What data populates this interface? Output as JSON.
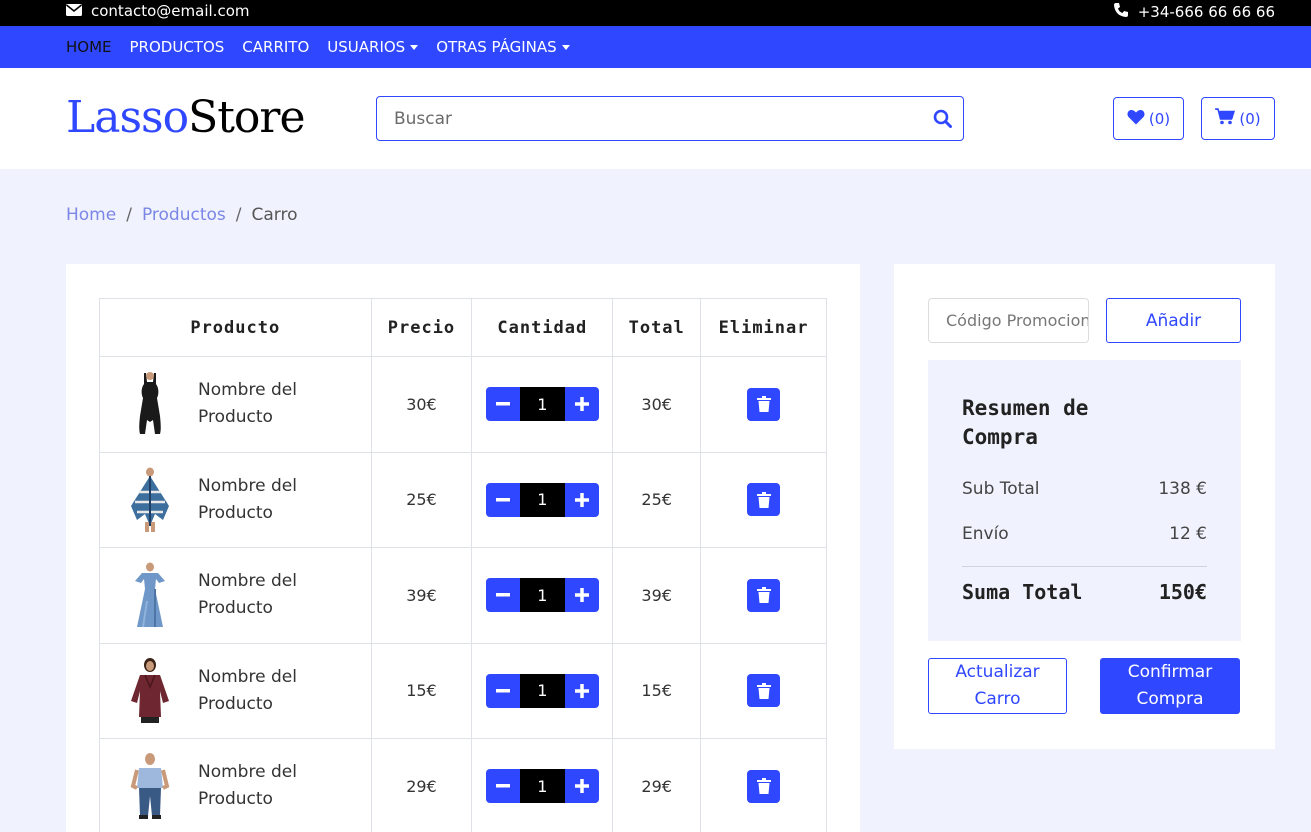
{
  "topbar": {
    "email": "contacto@email.com",
    "phone": "+34-666 66 66 66"
  },
  "nav": {
    "items": [
      {
        "label": "HOME",
        "active": true
      },
      {
        "label": "PRODUCTOS"
      },
      {
        "label": "CARRITO"
      },
      {
        "label": "USUARIOS",
        "dropdown": true
      },
      {
        "label": "OTRAS PÁGINAS",
        "dropdown": true
      }
    ]
  },
  "header": {
    "logo_part1": "Lasso",
    "logo_part2": "Store",
    "search_placeholder": "Buscar",
    "wishlist_count": "(0)",
    "cart_count": "(0)"
  },
  "breadcrumb": {
    "home": "Home",
    "products": "Productos",
    "current": "Carro",
    "sep": "/"
  },
  "table": {
    "headers": {
      "product": "Producto",
      "price": "Precio",
      "qty": "Cantidad",
      "total": "Total",
      "remove": "Eliminar"
    },
    "rows": [
      {
        "name_line1": "Nombre del",
        "name_line2": "Producto",
        "price": "30€",
        "qty": "1",
        "total": "30€",
        "thumb": "black-dress"
      },
      {
        "name_line1": "Nombre del",
        "name_line2": "Producto",
        "price": "25€",
        "qty": "1",
        "total": "25€",
        "thumb": "blue-poncho"
      },
      {
        "name_line1": "Nombre del",
        "name_line2": "Producto",
        "price": "39€",
        "qty": "1",
        "total": "39€",
        "thumb": "blue-maxi-dress"
      },
      {
        "name_line1": "Nombre del",
        "name_line2": "Producto",
        "price": "15€",
        "qty": "1",
        "total": "15€",
        "thumb": "burgundy-blouse"
      },
      {
        "name_line1": "Nombre del",
        "name_line2": "Producto",
        "price": "29€",
        "qty": "1",
        "total": "29€",
        "thumb": "kid-outfit"
      }
    ]
  },
  "summary": {
    "promo_placeholder": "Código Promocional",
    "promo_button": "Añadir",
    "title": "Resumen de Compra",
    "subtotal_label": "Sub Total",
    "subtotal_value": "138 €",
    "shipping_label": "Envío",
    "shipping_value": "12 €",
    "total_label": "Suma Total",
    "total_value": "150€",
    "update_line1": "Actualizar",
    "update_line2": "Carro",
    "confirm_line1": "Confirmar",
    "confirm_line2": "Compra"
  },
  "colors": {
    "accent": "#2f47ff",
    "topbar": "#000000",
    "page_bg": "#f0f3fe"
  }
}
